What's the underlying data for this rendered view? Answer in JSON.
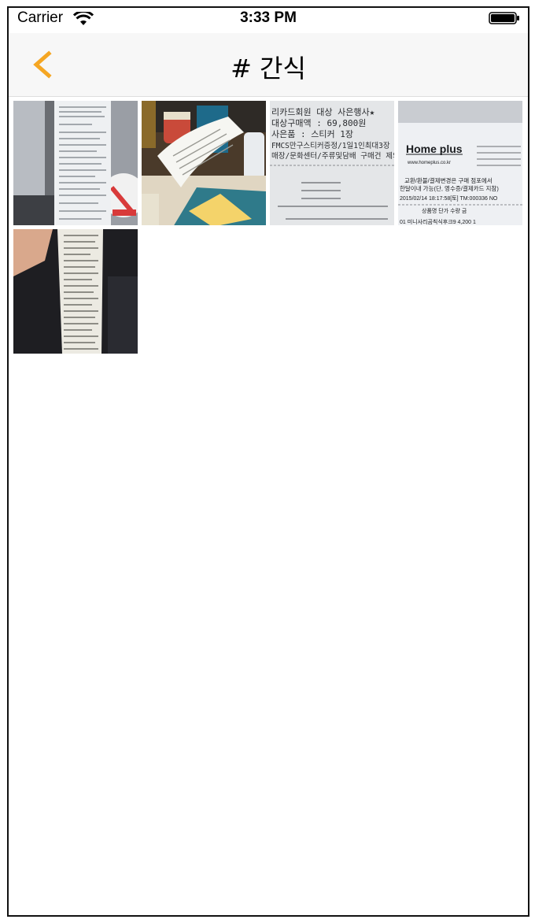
{
  "status_bar": {
    "carrier": "Carrier",
    "time": "3:33 PM",
    "icons": [
      "wifi-icon",
      "battery-icon"
    ]
  },
  "nav": {
    "back_icon": "chevron-left-icon",
    "title": "# 간식",
    "accent_color": "#f5a623"
  },
  "photos": [
    {
      "subject": "receipt-photo-1"
    },
    {
      "subject": "receipt-photo-2"
    },
    {
      "subject": "receipt-photo-3",
      "receipt_lines": [
        "리카드회원 대상 사은행사★",
        "대상구매액 : 69,800원",
        "사은품 : 스티커 1장",
        "FMCS만구스티커증정/1일1인최대3장",
        "매장/문화센터/주류및담배 구매건 제외"
      ]
    },
    {
      "subject": "receipt-photo-4",
      "receipt_lines": [
        "Home plus",
        "www.homeplus.co.kr",
        "교환/환불/결제변경은 구매 점포에서",
        "한달이내 가능(단, 영수증/결제카드 지참)",
        "2015/02/14 18:17:58[토] TM:000336 NO",
        "상품명 단가 수량 금",
        "01 미니사리곰칙식후크9 4,200 1"
      ]
    },
    {
      "subject": "receipt-photo-5"
    }
  ]
}
